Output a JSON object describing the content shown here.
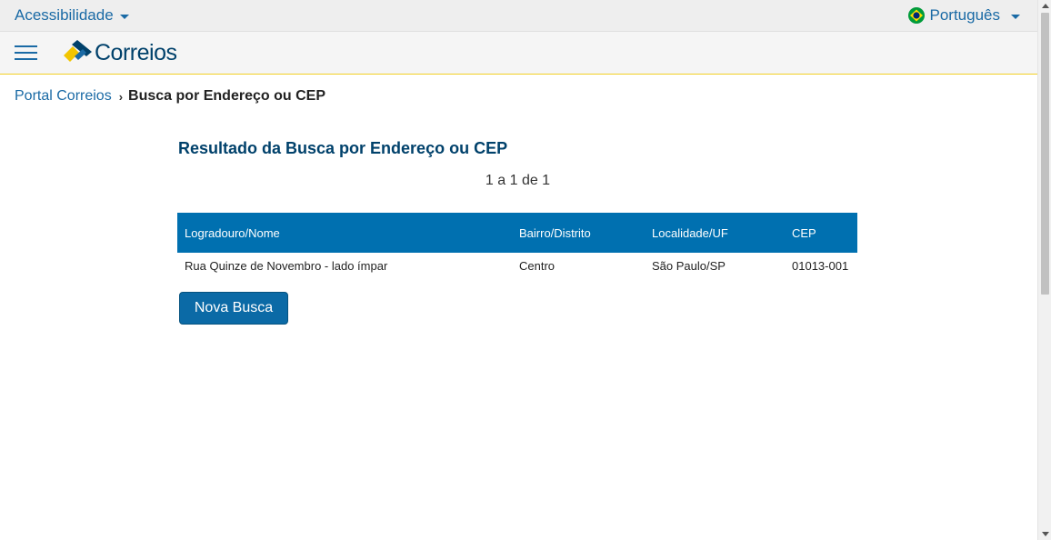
{
  "topbar": {
    "accessibility_label": "Acessibilidade",
    "language_label": "Português",
    "flag_icon": "brazil-flag-icon"
  },
  "header": {
    "menu_icon": "hamburger-menu-icon",
    "logo_text": "Correios",
    "accent_color": "#f2d024",
    "brand_color": "#00416b"
  },
  "breadcrumb": {
    "home": "Portal Correios",
    "separator": "›",
    "current": "Busca por Endereço ou CEP"
  },
  "results": {
    "title": "Resultado da Busca por Endereço ou CEP",
    "count": "1 a 1 de 1",
    "columns": [
      "Logradouro/Nome",
      "Bairro/Distrito",
      "Localidade/UF",
      "CEP"
    ],
    "rows": [
      [
        "Rua Quinze de Novembro - lado ímpar",
        "Centro",
        "São Paulo/SP",
        "01013-001"
      ]
    ],
    "header_color": "#0070b0"
  },
  "actions": {
    "new_search_label": "Nova Busca"
  }
}
